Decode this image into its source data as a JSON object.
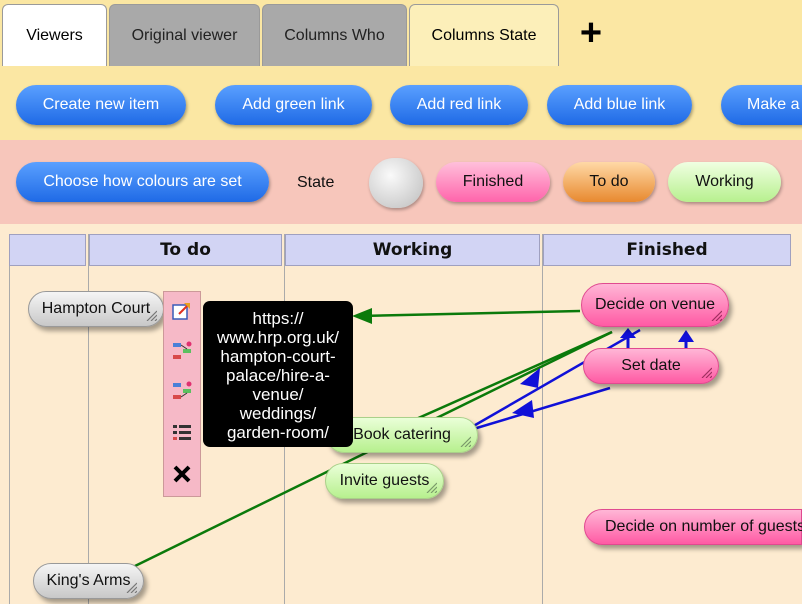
{
  "tabs": [
    {
      "label": "Viewers"
    },
    {
      "label": "Original viewer"
    },
    {
      "label": "Columns Who"
    },
    {
      "label": "Columns State"
    }
  ],
  "add_tab_label": "+",
  "toolbar": {
    "create": "Create new item",
    "green": "Add green link",
    "red": "Add red link",
    "blue": "Add blue link",
    "make": "Make a"
  },
  "colours": {
    "choose": "Choose how colours are set",
    "state_label": "State",
    "finished": "Finished",
    "todo": "To do",
    "working": "Working"
  },
  "columns": [
    "",
    "To do",
    "Working",
    "Finished"
  ],
  "nodes": {
    "hampton": "Hampton Court",
    "kings": "King's Arms",
    "catering": "Book catering",
    "invite": "Invite guests",
    "venue": "Decide on venue",
    "date": "Set date",
    "number": "Decide on number of guests"
  },
  "tooltip_lines": [
    "https://",
    "www.hrp.org.uk/",
    "hampton-court-",
    "palace/hire-a-",
    "venue/",
    "weddings/",
    "garden-room/"
  ],
  "colors": {
    "accent_blue": "#1f6ae6",
    "link_green": "#0b7a0b",
    "link_blue": "#1010d8",
    "finished_pink": "#ff5aa4",
    "todo_orange": "#e8892f",
    "working_green": "#b7f08e"
  }
}
